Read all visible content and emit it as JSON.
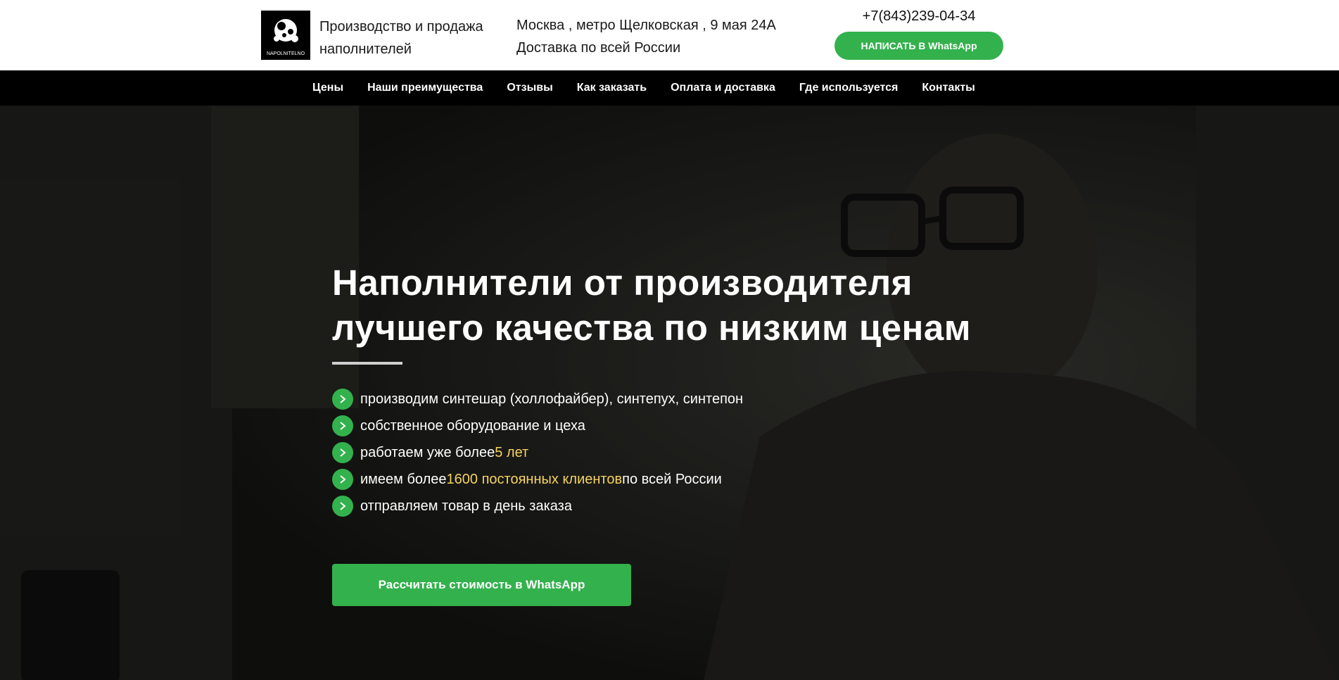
{
  "header": {
    "logo_text": "NAPOLNITELNO",
    "tagline": "Производство и продажа наполнителей",
    "address_line1": "Москва , метро Щелковская , 9 мая 24А",
    "address_line2": "Доставка по всей России",
    "phone": "+7(843)239-04-34",
    "whatsapp_button": "НАПИСАТЬ В WhatsApp"
  },
  "nav": {
    "items": [
      {
        "label": "Цены"
      },
      {
        "label": "Наши преимущества"
      },
      {
        "label": "Отзывы"
      },
      {
        "label": "Как заказать"
      },
      {
        "label": "Оплата и доставка"
      },
      {
        "label": "Где используется"
      },
      {
        "label": "Контакты"
      }
    ]
  },
  "hero": {
    "title_line1": "Наполнители от производителя",
    "title_line2": "лучшего качества по низким ценам",
    "features": [
      {
        "text": "производим синтешар (холлофайбер), синтепух, синтепон"
      },
      {
        "text": "собственное оборудование и цеха"
      },
      {
        "text_before": "работаем уже более ",
        "highlight": "5 лет",
        "text_after": ""
      },
      {
        "text_before": "имеем более ",
        "highlight": "1600 постоянных клиентов",
        "text_after": " по всей России"
      },
      {
        "text": "отправляем товар в день заказа"
      }
    ],
    "cta_button": "Рассчитать стоимость в WhatsApp"
  },
  "colors": {
    "accent_green": "#33b14d",
    "highlight_yellow": "#f4d35e",
    "nav_bg": "#000000"
  }
}
